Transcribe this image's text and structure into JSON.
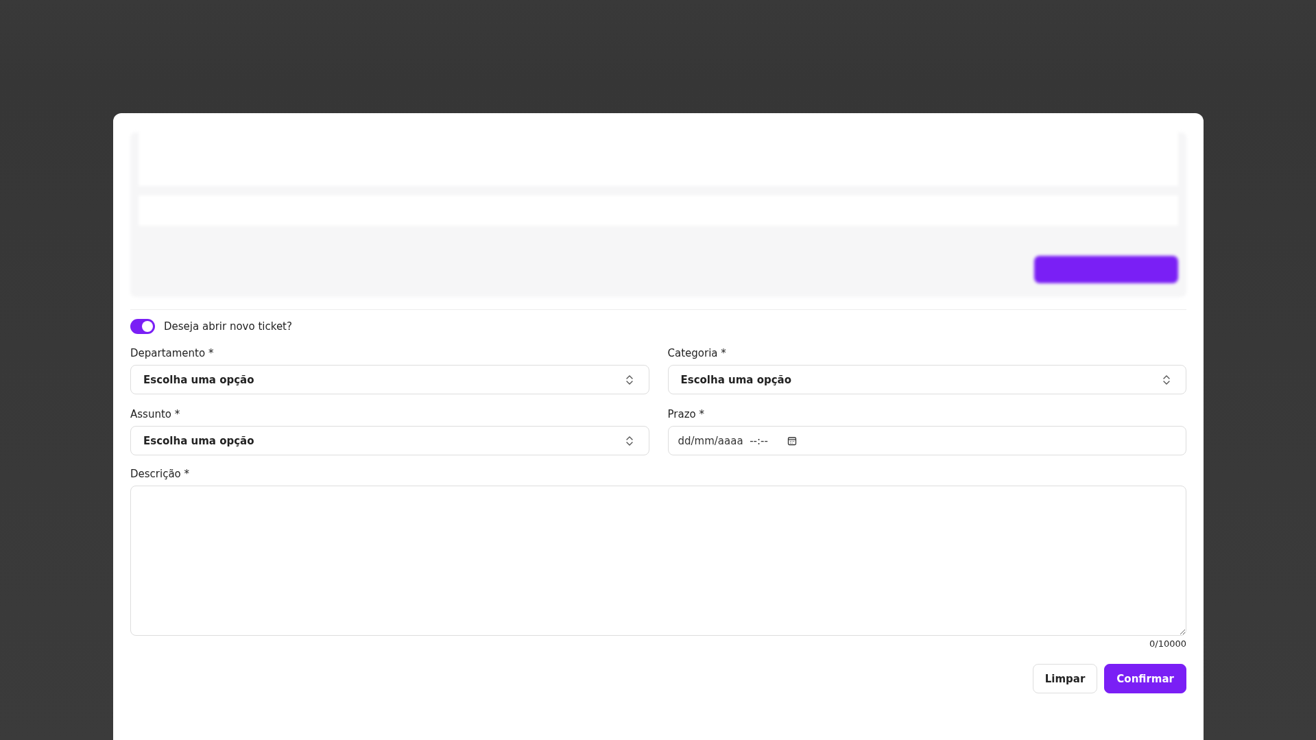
{
  "new_ticket_toggle": {
    "label": "Deseja abrir novo ticket?",
    "on": true
  },
  "fields": [
    {
      "kind": "select",
      "label": "Departamento *",
      "value": "Escolha uma opção"
    },
    {
      "kind": "select",
      "label": "Categoria *",
      "value": "Escolha uma opção"
    },
    {
      "kind": "select",
      "label": "Assunto *",
      "value": "Escolha uma opção"
    },
    {
      "kind": "datetime",
      "label": "Prazo *",
      "value": "dd/mm/aaaa  --:--"
    }
  ],
  "description": {
    "label": "Descrição *",
    "counter": "0/10000"
  },
  "buttons": [
    {
      "kind": "secondary",
      "label": "Limpar"
    },
    {
      "kind": "primary",
      "label": "Confirmar"
    }
  ]
}
